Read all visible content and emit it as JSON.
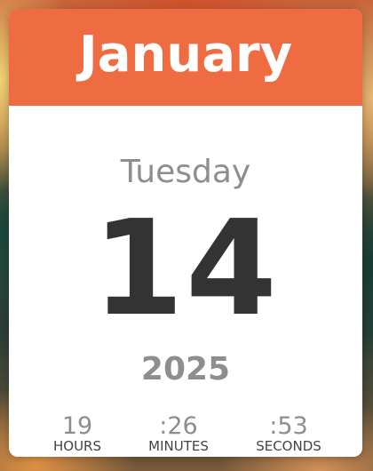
{
  "calendar": {
    "month": "January",
    "weekday": "Tuesday",
    "day": "14",
    "year": "2025"
  },
  "clock": {
    "hours": {
      "value": "19",
      "label": "HOURS"
    },
    "minutes": {
      "value": ":26",
      "label": "MINUTES"
    },
    "seconds": {
      "value": ":53",
      "label": "SECONDS"
    }
  },
  "colors": {
    "header": "#ef6c43",
    "card": "#ffffff",
    "day_text": "#333333",
    "muted_text": "#8e8e8e"
  }
}
